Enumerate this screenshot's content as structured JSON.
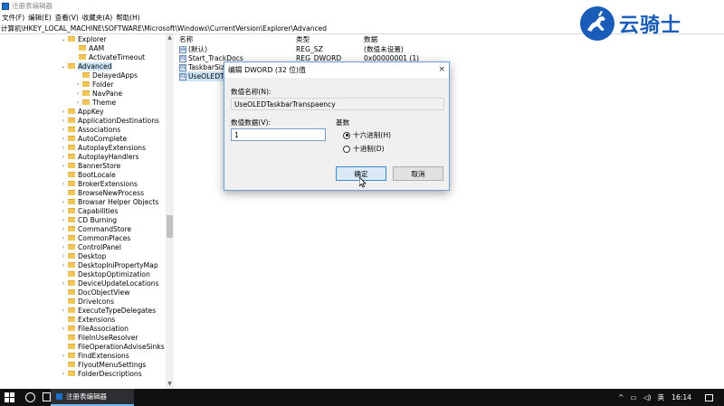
{
  "window": {
    "title": "注册表编辑器"
  },
  "menu": [
    "文件(F)",
    "编辑(E)",
    "查看(V)",
    "收藏夹(A)",
    "帮助(H)"
  ],
  "address": "计算机\\HKEY_LOCAL_MACHINE\\SOFTWARE\\Microsoft\\Windows\\CurrentVersion\\Explorer\\Advanced",
  "tree": [
    {
      "label": "Explorer",
      "expander": "v"
    },
    {
      "label": "AAM",
      "expander": ""
    },
    {
      "label": "ActivateTimeout",
      "expander": ""
    },
    {
      "label": "Advanced",
      "expander": "v"
    },
    {
      "label": "DelayedApps",
      "expander": ""
    },
    {
      "label": "Folder",
      "expander": ">"
    },
    {
      "label": "NavPane",
      "expander": ">"
    },
    {
      "label": "Theme",
      "expander": ">"
    },
    {
      "label": "AppKey",
      "expander": ">"
    },
    {
      "label": "ApplicationDestinations",
      "expander": ">"
    },
    {
      "label": "Associations",
      "expander": ">"
    },
    {
      "label": "AutoComplete",
      "expander": ">"
    },
    {
      "label": "AutoplayExtensions",
      "expander": ">"
    },
    {
      "label": "AutoplayHandlers",
      "expander": ">"
    },
    {
      "label": "BannerStore",
      "expander": ">"
    },
    {
      "label": "BootLocale",
      "expander": ""
    },
    {
      "label": "BrokerExtensions",
      "expander": ">"
    },
    {
      "label": "BrowseNewProcess",
      "expander": ""
    },
    {
      "label": "Browser Helper Objects",
      "expander": ">"
    },
    {
      "label": "Capabilities",
      "expander": ">"
    },
    {
      "label": "CD Burning",
      "expander": ">"
    },
    {
      "label": "CommandStore",
      "expander": ">"
    },
    {
      "label": "CommonPlaces",
      "expander": ">"
    },
    {
      "label": "ControlPanel",
      "expander": ">"
    },
    {
      "label": "Desktop",
      "expander": ">"
    },
    {
      "label": "DesktopIniPropertyMap",
      "expander": ">"
    },
    {
      "label": "DesktopOptimization",
      "expander": ""
    },
    {
      "label": "DeviceUpdateLocations",
      "expander": ">"
    },
    {
      "label": "DocObjectView",
      "expander": ""
    },
    {
      "label": "DriveIcons",
      "expander": ""
    },
    {
      "label": "ExecuteTypeDelegates",
      "expander": ">"
    },
    {
      "label": "Extensions",
      "expander": ""
    },
    {
      "label": "FileAssociation",
      "expander": ">"
    },
    {
      "label": "FileInUseResolver",
      "expander": ""
    },
    {
      "label": "FileOperationAdviseSinks",
      "expander": ""
    },
    {
      "label": "FindExtensions",
      "expander": ">"
    },
    {
      "label": "FlyoutMenuSettings",
      "expander": ""
    },
    {
      "label": "FolderDescriptions",
      "expander": ">"
    }
  ],
  "list": {
    "headers": {
      "name": "名称",
      "type": "类型",
      "data": "数据"
    },
    "rows": [
      {
        "icon": "ab",
        "name": "(默认)",
        "type": "REG_SZ",
        "data": "(数值未设置)"
      },
      {
        "icon": "01",
        "name": "Start_TrackDocs",
        "type": "REG_DWORD",
        "data": "0x00000001 (1)"
      },
      {
        "icon": "01",
        "name": "TaskbarSiz",
        "type": "",
        "data": ""
      },
      {
        "icon": "01",
        "name": "UseOLEDTa",
        "type": "",
        "data": ""
      }
    ]
  },
  "logo": {
    "text": "云骑士",
    "icon": "horse-rider-icon"
  },
  "dialog": {
    "title": "编辑 DWORD (32 位)值",
    "close": "×",
    "name_label": "数值名称(N):",
    "name_value": "UseOLEDTaskbarTranspaency",
    "data_label": "数值数据(V):",
    "data_value": "1",
    "base_label": "基数",
    "hex_label": "十六进制(H)",
    "dec_label": "十进制(D)",
    "ok": "确定",
    "cancel": "取消",
    "hex_checked": true
  },
  "taskbar": {
    "app_label": "注册表编辑器",
    "tray_arrow": "^",
    "ime": "英",
    "clock": "16:14"
  },
  "colors": {
    "accent": "#3a8ad8",
    "taskbar": "#101113",
    "logo": "#1a5db8"
  }
}
